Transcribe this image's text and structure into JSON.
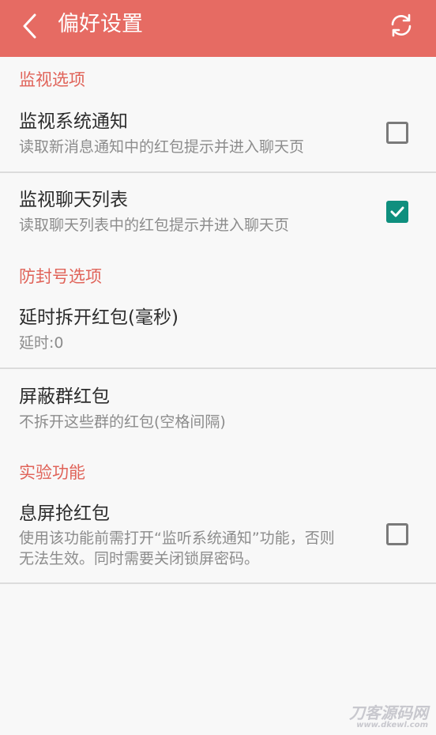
{
  "appbar": {
    "title": "偏好设置",
    "back_icon": "chevron-left-icon",
    "refresh_icon": "refresh-icon",
    "background_color": "#e66b63"
  },
  "sections": [
    {
      "header": "监视选项",
      "items": [
        {
          "title": "监视系统通知",
          "summary": "读取新消息通知中的红包提示并进入聊天页",
          "checked": false
        },
        {
          "title": "监视聊天列表",
          "summary": "读取聊天列表中的红包提示并进入聊天页",
          "checked": true
        }
      ]
    },
    {
      "header": "防封号选项",
      "items": [
        {
          "title": "延时拆开红包(毫秒)",
          "summary": "延时:0"
        },
        {
          "title": "屏蔽群红包",
          "summary": "不拆开这些群的红包(空格间隔)"
        }
      ]
    },
    {
      "header": "实验功能",
      "items": [
        {
          "title": "息屏抢红包",
          "summary_line1": "使用该功能前需打开“监听系统通知”功能，否则",
          "summary_line2": "无法生效。同时需要关闭锁屏密码。",
          "checked": false
        }
      ]
    }
  ],
  "colors": {
    "accent": "#e06359",
    "checkbox_checked": "#0f8f7e"
  },
  "watermark": {
    "text": "刀客源码网",
    "url": "www.dkewl.com"
  }
}
